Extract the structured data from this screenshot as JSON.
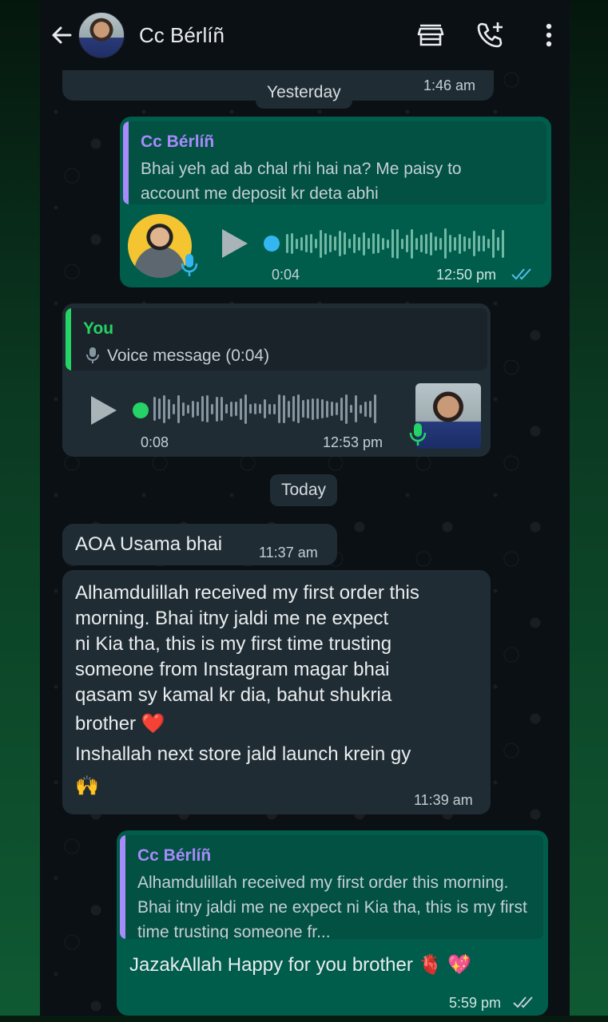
{
  "header": {
    "contact_name": "Cc Bérlíñ"
  },
  "icons": {
    "back": "arrow-left-icon",
    "store": "store-icon",
    "call": "add-call-icon",
    "menu": "more-vertical-icon"
  },
  "colors": {
    "incoming_bubble": "#202c33",
    "outgoing_bubble": "#005c4b",
    "accent_green": "#25d366",
    "voice_dot_blue": "#34b7f1",
    "read_ticks": "#53bdeb",
    "quote_name_purple": "#a78bfa"
  },
  "chat": {
    "top_partial_time": "1:46 am",
    "date_yesterday": "Yesterday",
    "date_today": "Today",
    "msg1": {
      "quote_name": "Cc Bérlíñ",
      "quote_text": "Bhai yeh ad ab chal rhi hai na? Me paisy to account me deposit kr deta abhi",
      "voice_duration": "0:04",
      "time": "12:50 pm"
    },
    "msg2": {
      "quote_name": "You",
      "quote_text": "Voice message (0:04)",
      "voice_duration": "0:08",
      "time": "12:53 pm"
    },
    "msg3": {
      "text": "AOA Usama bhai",
      "time": "11:37 am"
    },
    "msg4": {
      "text1": "Alhamdulillah received my first order this",
      "text2": "morning. Bhai itny jaldi me ne expect",
      "text3": "ni Kia tha, this is my first time trusting",
      "text4": "someone from Instagram magar bhai",
      "text5": "qasam sy kamal kr dia, bahut shukria",
      "text6": "brother ❤️",
      "text7": "Inshallah next store jald launch krein gy",
      "text8": "🙌",
      "time": "11:39 am"
    },
    "msg5": {
      "quote_name": "Cc Bérlíñ",
      "quote_text": "Alhamdulillah received my first order this morning. Bhai itny jaldi me ne expect ni Kia tha, this is my first time trusting someone fr...",
      "text": "JazakAllah Happy for you brother 🫀 💖",
      "time": "5:59 pm"
    }
  }
}
